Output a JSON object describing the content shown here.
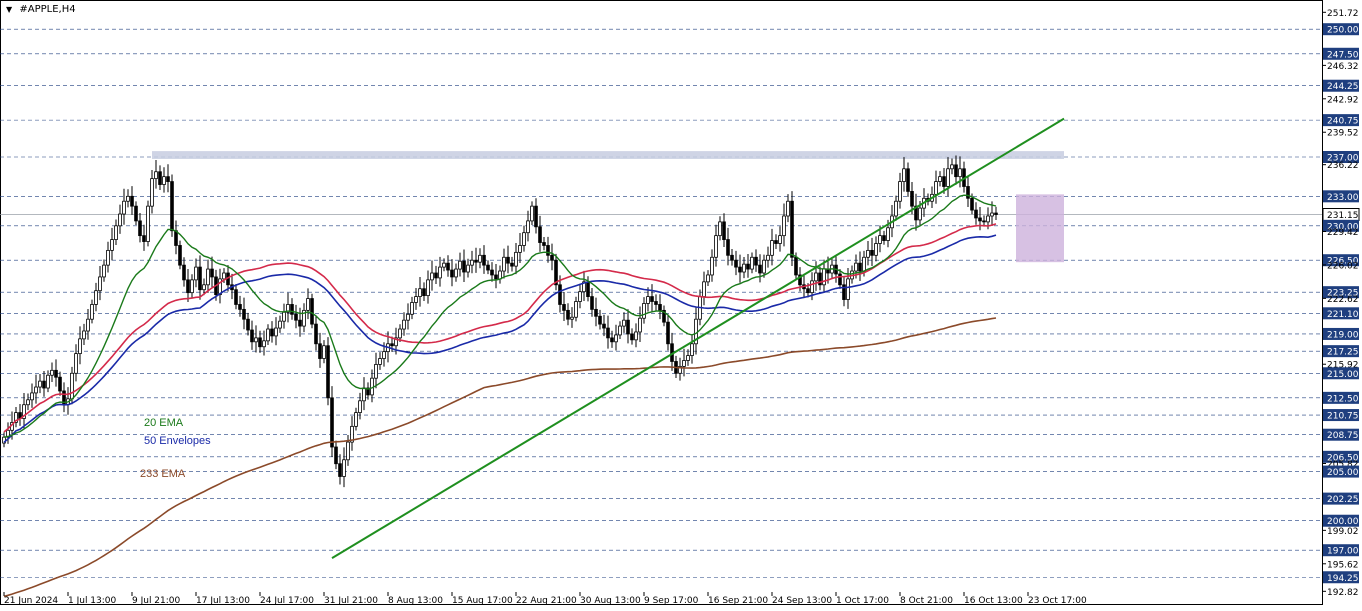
{
  "header": {
    "symbol_title": "#APPLE,H4",
    "menu_icon": "triangle-down-icon"
  },
  "colors": {
    "background": "#ffffff",
    "grid": "#1f3f7f",
    "candle": "#000000",
    "ema20": "#1a7a1a",
    "envelope_upper": "#d42a4a",
    "envelope_lower": "#1a2aa8",
    "ema233": "#8b4a2a",
    "trendline": "#1f8f1f",
    "resistance_zone": "#c7cde0",
    "consolidation_box": "#cdb2dc",
    "price_label_bg": "#1f3f7f",
    "price_label_text": "#ffffff",
    "current_price_bg": "#ffffff"
  },
  "legend": [
    {
      "label": "20 EMA",
      "color": "#1a7a1a"
    },
    {
      "label": "50 Envelopes",
      "color": "#1a2aa8"
    },
    {
      "label": "233 EMA",
      "color": "#8b4a2a"
    }
  ],
  "chart_data": {
    "type": "candlestick",
    "symbol": "#APPLE",
    "timeframe": "H4",
    "ylim": [
      192.75,
      251.75
    ],
    "y_ticks": [
      "251.72",
      "250.00",
      "247.50",
      "246.32",
      "244.25",
      "242.92",
      "240.75",
      "239.52",
      "237.00",
      "236.22",
      "233.00",
      "231.15",
      "230.00",
      "229.42",
      "226.50",
      "226.02",
      "223.25",
      "222.62",
      "221.10",
      "219.00",
      "217.25",
      "215.92",
      "215.00",
      "212.50",
      "210.75",
      "208.75",
      "206.50",
      "205.82",
      "205.00",
      "202.25",
      "200.00",
      "199.02",
      "197.00",
      "195.62",
      "194.25",
      "192.82"
    ],
    "highlighted_levels": [
      250.0,
      247.5,
      244.25,
      240.75,
      237.0,
      233.0,
      230.0,
      226.5,
      223.25,
      221.1,
      219.0,
      217.25,
      215.0,
      212.5,
      210.75,
      208.75,
      206.5,
      205.0,
      202.25,
      200.0,
      197.0,
      194.25
    ],
    "current_price": "231.15",
    "x_labels": [
      "21 Jun 2024",
      "1 Jul 13:00",
      "9 Jul 21:00",
      "17 Jul 13:00",
      "24 Jul 17:00",
      "31 Jul 21:00",
      "8 Aug 13:00",
      "15 Aug 17:00",
      "22 Aug 21:00",
      "30 Aug 13:00",
      "9 Sep 17:00",
      "16 Sep 21:00",
      "24 Sep 13:00",
      "1 Oct 17:00",
      "8 Oct 21:00",
      "16 Oct 13:00",
      "23 Oct 17:00"
    ],
    "x_label_index": [
      0,
      16,
      32,
      48,
      64,
      80,
      96,
      112,
      128,
      144,
      160,
      176,
      192,
      208,
      224,
      240,
      256
    ],
    "closes": [
      208.5,
      209.2,
      210.0,
      211.0,
      210.4,
      211.8,
      212.3,
      213.0,
      213.6,
      214.2,
      213.5,
      214.8,
      215.3,
      214.6,
      213.2,
      211.8,
      212.4,
      215.0,
      217.0,
      218.5,
      219.3,
      220.5,
      222.0,
      223.4,
      224.8,
      226.0,
      227.5,
      228.6,
      230.0,
      231.2,
      232.5,
      233.0,
      232.0,
      230.5,
      229.0,
      228.4,
      232.0,
      234.8,
      235.5,
      234.2,
      235.0,
      234.5,
      229.5,
      228.0,
      226.0,
      224.5,
      223.2,
      224.5,
      225.8,
      223.5,
      224.0,
      225.6,
      224.8,
      223.0,
      224.6,
      225.2,
      224.0,
      223.5,
      222.0,
      221.5,
      220.5,
      219.4,
      218.2,
      218.6,
      217.7,
      218.3,
      219.5,
      218.8,
      219.6,
      220.3,
      221.2,
      222.0,
      221.0,
      220.4,
      219.8,
      221.4,
      222.6,
      220.0,
      218.0,
      216.5,
      217.8,
      212.5,
      207.5,
      205.8,
      204.5,
      206.2,
      208.0,
      209.6,
      211.0,
      212.2,
      213.5,
      212.8,
      214.5,
      215.9,
      216.5,
      217.2,
      218.0,
      217.8,
      218.6,
      219.5,
      220.4,
      221.0,
      222.2,
      222.8,
      223.6,
      222.9,
      224.5,
      225.2,
      224.7,
      225.8,
      226.2,
      225.5,
      224.8,
      225.6,
      226.4,
      225.3,
      226.0,
      226.5,
      226.3,
      227.0,
      226.0,
      225.5,
      225.0,
      224.6,
      225.4,
      226.8,
      226.2,
      225.9,
      227.3,
      228.0,
      229.3,
      230.5,
      232.0,
      229.9,
      228.3,
      228.0,
      227.0,
      226.5,
      224.0,
      222.0,
      221.4,
      220.5,
      220.7,
      222.3,
      223.3,
      224.3,
      222.8,
      221.5,
      220.8,
      220.0,
      219.6,
      218.6,
      218.2,
      218.9,
      219.8,
      220.4,
      219.0,
      218.4,
      219.2,
      220.6,
      222.1,
      222.8,
      222.3,
      222.0,
      221.4,
      220.2,
      218.0,
      216.2,
      215.0,
      215.7,
      216.3,
      216.8,
      218.0,
      220.5,
      222.8,
      224.3,
      225.0,
      226.8,
      229.0,
      230.4,
      228.6,
      227.0,
      226.5,
      225.8,
      225.3,
      226.1,
      225.6,
      226.8,
      226.0,
      225.2,
      226.5,
      227.0,
      228.5,
      228.2,
      229.0,
      231.0,
      232.5,
      226.8,
      225.0,
      224.0,
      223.6,
      223.2,
      224.4,
      225.2,
      224.0,
      225.6,
      225.2,
      226.0,
      225.1,
      224.0,
      222.5,
      224.6,
      225.4,
      226.2,
      225.4,
      226.8,
      227.5,
      227.0,
      228.2,
      229.0,
      228.5,
      229.8,
      231.0,
      232.5,
      234.5,
      235.8,
      233.5,
      232.0,
      230.6,
      231.8,
      232.8,
      232.5,
      233.2,
      234.5,
      235.0,
      234.0,
      235.8,
      236.2,
      235.0,
      235.8,
      234.0,
      232.8,
      231.6,
      230.8,
      230.5,
      230.4,
      231.0,
      231.3,
      231.15
    ],
    "indicators": [
      {
        "name": "20 EMA",
        "period": 20,
        "source": "close"
      },
      {
        "name": "50 Envelopes",
        "period": 50,
        "deviation_pct": 0.25
      },
      {
        "name": "233 EMA",
        "period": 233,
        "source": "close"
      }
    ],
    "annotations": {
      "trendline": {
        "from": {
          "bar_index": 82,
          "price": 196.2
        },
        "to": {
          "bar_index": 265,
          "price": 240.9
        }
      },
      "resistance_zone": {
        "from_bar": 37,
        "to_bar": 265,
        "price_low": 236.8,
        "price_high": 237.6
      },
      "consolidation_box": {
        "from_bar": 253,
        "to_bar": 265,
        "price_low": 226.3,
        "price_high": 233.2
      }
    }
  }
}
